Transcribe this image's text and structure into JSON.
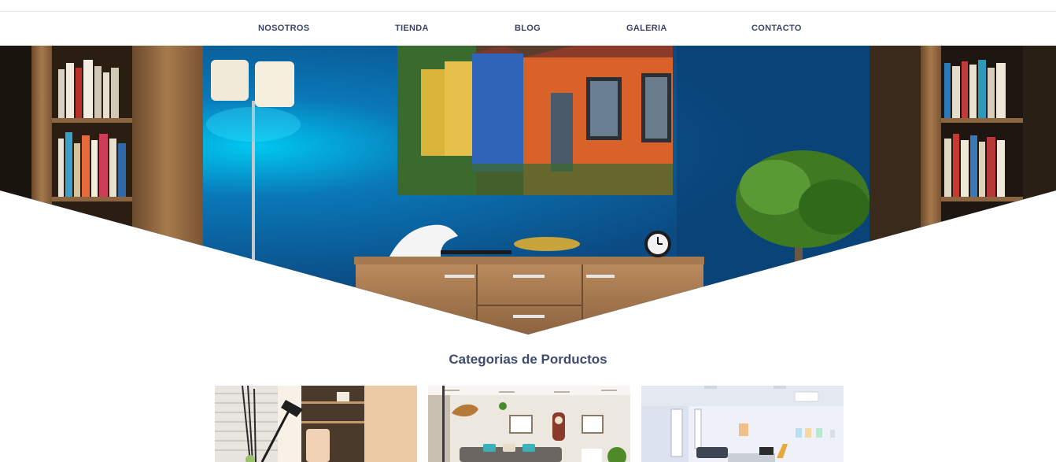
{
  "nav": {
    "items": [
      {
        "label": "NOSOTROS"
      },
      {
        "label": "TIENDA"
      },
      {
        "label": "BLOG"
      },
      {
        "label": "GALERIA"
      },
      {
        "label": "CONTACTO"
      }
    ]
  },
  "section": {
    "title": "Categorias de Porductos"
  },
  "colors": {
    "nav_text": "#3b4466",
    "title": "#3e4a70",
    "hero_wall": "#0b4a82"
  }
}
